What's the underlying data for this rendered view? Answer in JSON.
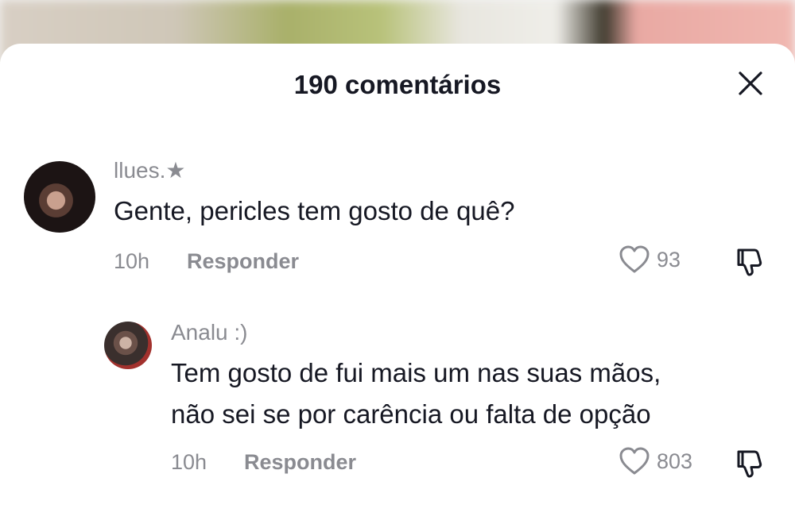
{
  "header": {
    "title": "190 comentários"
  },
  "comments": [
    {
      "username": "llues.★",
      "text": "Gente, pericles tem gosto de quê?",
      "time": "10h",
      "reply_label": "Responder",
      "likes": "93"
    },
    {
      "username": "Analu :)",
      "text_line1": "Tem gosto de fui mais um nas suas mãos,",
      "text_line2": "não sei se por carência ou falta de opção",
      "time": "10h",
      "reply_label": "Responder",
      "likes": "803"
    }
  ],
  "icons": {
    "close": "close-icon",
    "like": "heart-outline-icon",
    "dislike": "thumbs-down-icon"
  },
  "colors": {
    "text_primary": "#161823",
    "text_secondary": "#8a8b91",
    "sheet": "#ffffff"
  }
}
